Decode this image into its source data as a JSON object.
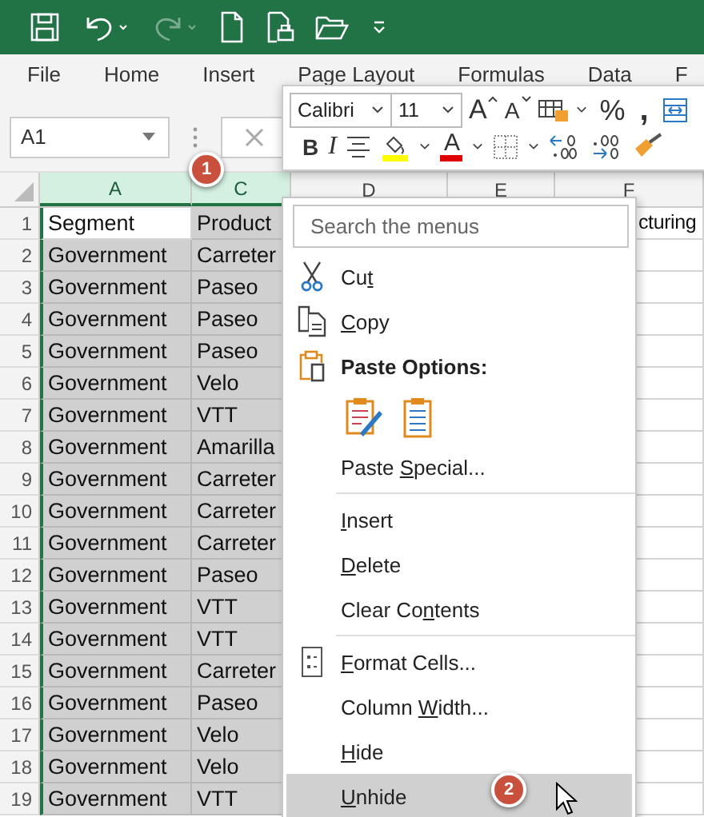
{
  "ribbon_tabs": [
    "File",
    "Home",
    "Insert",
    "Page Layout",
    "Formulas",
    "Data",
    "F"
  ],
  "name_box": {
    "value": "A1"
  },
  "mini_toolbar": {
    "font": "Calibri",
    "size": "11",
    "grow_font": "A",
    "shrink_font": "A",
    "percent": "%",
    "comma": ",",
    "bold": "B",
    "italic": "I",
    "font_color": "A"
  },
  "columns": [
    {
      "label": "A",
      "selected": true
    },
    {
      "label": "C",
      "selected": true
    },
    {
      "label": "D",
      "selected": false
    },
    {
      "label": "E",
      "selected": false
    },
    {
      "label": "F",
      "selected": false
    }
  ],
  "rows": [
    {
      "number": "1",
      "active": true,
      "col_a": "Segment",
      "col_c": "Product",
      "col_f": "cturing"
    },
    {
      "number": "2",
      "active": false,
      "col_a": "Government",
      "col_c": "Carreter"
    },
    {
      "number": "3",
      "active": false,
      "col_a": "Government",
      "col_c": "Paseo"
    },
    {
      "number": "4",
      "active": false,
      "col_a": "Government",
      "col_c": "Paseo"
    },
    {
      "number": "5",
      "active": false,
      "col_a": "Government",
      "col_c": "Paseo"
    },
    {
      "number": "6",
      "active": false,
      "col_a": "Government",
      "col_c": "Velo"
    },
    {
      "number": "7",
      "active": false,
      "col_a": "Government",
      "col_c": "VTT"
    },
    {
      "number": "8",
      "active": false,
      "col_a": "Government",
      "col_c": "Amarilla"
    },
    {
      "number": "9",
      "active": false,
      "col_a": "Government",
      "col_c": "Carreter"
    },
    {
      "number": "10",
      "active": false,
      "col_a": "Government",
      "col_c": "Carreter"
    },
    {
      "number": "11",
      "active": false,
      "col_a": "Government",
      "col_c": "Carreter"
    },
    {
      "number": "12",
      "active": false,
      "col_a": "Government",
      "col_c": "Paseo"
    },
    {
      "number": "13",
      "active": false,
      "col_a": "Government",
      "col_c": "VTT"
    },
    {
      "number": "14",
      "active": false,
      "col_a": "Government",
      "col_c": "VTT"
    },
    {
      "number": "15",
      "active": false,
      "col_a": "Government",
      "col_c": "Carreter"
    },
    {
      "number": "16",
      "active": false,
      "col_a": "Government",
      "col_c": "Paseo"
    },
    {
      "number": "17",
      "active": false,
      "col_a": "Government",
      "col_c": "Velo"
    },
    {
      "number": "18",
      "active": false,
      "col_a": "Government",
      "col_c": "Velo"
    },
    {
      "number": "19",
      "active": false,
      "col_a": "Government",
      "col_c": "VTT"
    }
  ],
  "context_menu": {
    "search_placeholder": "Search the menus",
    "items": [
      {
        "kind": "cut",
        "before": "Cu",
        "key": "t",
        "selected": false
      },
      {
        "kind": "copy",
        "key": "C",
        "after": "opy",
        "selected": false
      },
      {
        "kind": "heading",
        "label": "Paste Options:"
      },
      {
        "kind": "paste_options"
      },
      {
        "kind": "command",
        "before": "Paste ",
        "key": "S",
        "after": "pecial...",
        "selected": false
      },
      {
        "kind": "separator"
      },
      {
        "kind": "command",
        "key": "I",
        "after": "nsert",
        "selected": false
      },
      {
        "kind": "command",
        "key": "D",
        "after": "elete",
        "selected": false
      },
      {
        "kind": "command",
        "before": "Clear Co",
        "key": "n",
        "after": "tents",
        "selected": false
      },
      {
        "kind": "separator"
      },
      {
        "kind": "format",
        "key": "F",
        "after": "ormat Cells...",
        "selected": false
      },
      {
        "kind": "command",
        "before": "Column ",
        "key": "W",
        "after": "idth...",
        "selected": false
      },
      {
        "kind": "command",
        "key": "H",
        "after": "ide",
        "selected": false
      },
      {
        "kind": "command",
        "key": "U",
        "after": "nhide",
        "selected": true
      }
    ]
  },
  "callouts": [
    "1",
    "2"
  ]
}
